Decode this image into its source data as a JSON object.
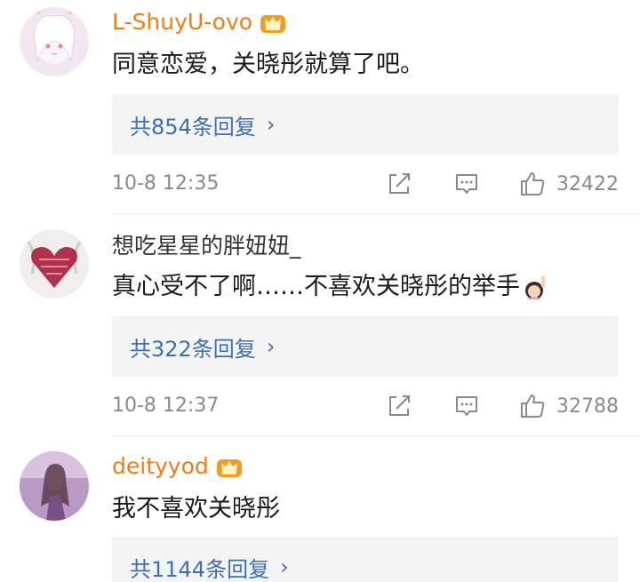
{
  "comments": [
    {
      "username": "L-ShuyU-ovo",
      "vip": true,
      "text": "同意恋爱，关晓彤就算了吧。",
      "replies_label": "共854条回复",
      "time": "10-8 12:35",
      "likes": "32422"
    },
    {
      "username": "想吃星星的胖妞妞_",
      "vip": false,
      "text": "真心受不了啊……不喜欢关晓彤的举手",
      "replies_label": "共322条回复",
      "time": "10-8 12:37",
      "likes": "32788"
    },
    {
      "username": "deityyod",
      "vip": true,
      "text": "我不喜欢关晓彤",
      "replies_label": "共1144条回复"
    }
  ],
  "icons": {
    "crown": "crown-badge-icon",
    "reply_chevron": "chevron-right-icon",
    "share": "share-edit-icon",
    "comment": "comment-bubble-icon",
    "like": "thumbs-up-icon",
    "hand_emoji": "raised-hand-emoji"
  },
  "colors": {
    "vip_name": "#f07d1a",
    "link_blue": "#3d6fb3",
    "meta_gray": "#8a8a8a",
    "reply_bg": "#f4f4f4"
  }
}
